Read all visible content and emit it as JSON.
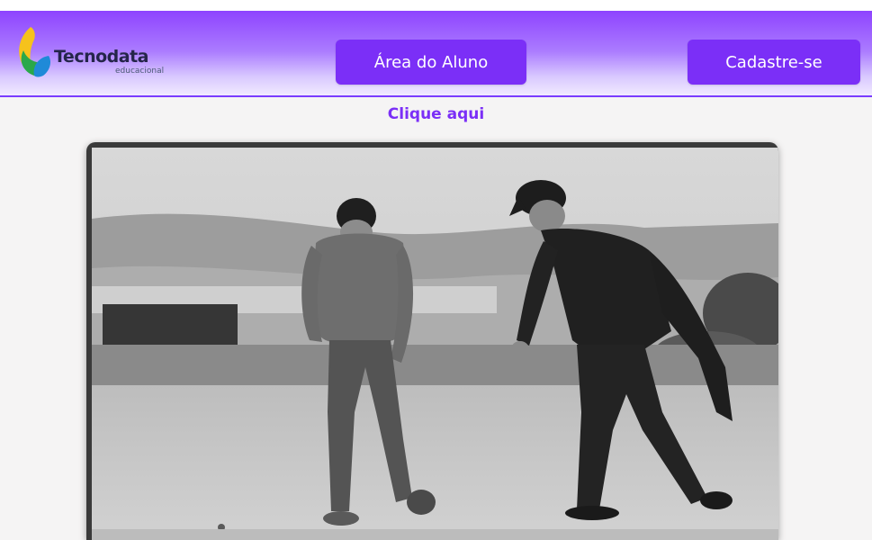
{
  "header": {
    "logo": {
      "name": "Tecnodata",
      "subtitle": "educacional"
    },
    "buttons": {
      "aluno": "Área do Aluno",
      "cadastro": "Cadastre-se"
    }
  },
  "main": {
    "clique_link": "Clique aqui"
  },
  "colors": {
    "accent": "#7b2ff7",
    "header_gradient_top": "#8e43ff",
    "background": "#f5f4f4"
  },
  "icons": {
    "logo": "tecnodata-leaf-logo-icon"
  }
}
